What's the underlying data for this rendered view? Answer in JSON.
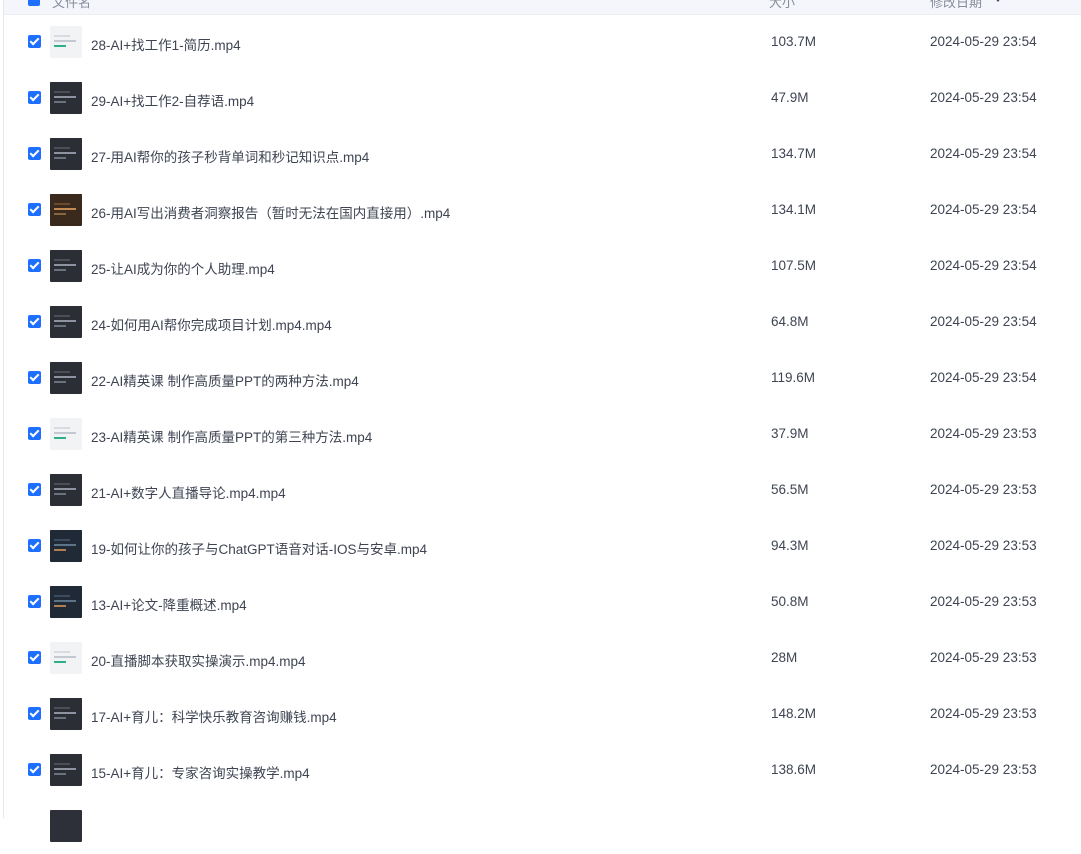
{
  "header": {
    "name_label": "文件名",
    "size_label": "大小",
    "date_label": "修改日期"
  },
  "rows": [
    {
      "name": "28-AI+找工作1-简历.mp4",
      "size": "103.7M",
      "date": "2024-05-29 23:54",
      "thumb": "light"
    },
    {
      "name": "29-AI+找工作2-自荐语.mp4",
      "size": "47.9M",
      "date": "2024-05-29 23:54",
      "thumb": "dark"
    },
    {
      "name": "27-用AI帮你的孩子秒背单词和秒记知识点.mp4",
      "size": "134.7M",
      "date": "2024-05-29 23:54",
      "thumb": "dark"
    },
    {
      "name": "26-用AI写出消费者洞察报告（暂时无法在国内直接用）.mp4",
      "size": "134.1M",
      "date": "2024-05-29 23:54",
      "thumb": "warm"
    },
    {
      "name": "25-让AI成为你的个人助理.mp4",
      "size": "107.5M",
      "date": "2024-05-29 23:54",
      "thumb": "dark"
    },
    {
      "name": "24-如何用AI帮你完成项目计划.mp4.mp4",
      "size": "64.8M",
      "date": "2024-05-29 23:54",
      "thumb": "dark"
    },
    {
      "name": "22-AI精英课 制作高质量PPT的两种方法.mp4",
      "size": "119.6M",
      "date": "2024-05-29 23:54",
      "thumb": "dark"
    },
    {
      "name": "23-AI精英课 制作高质量PPT的第三种方法.mp4",
      "size": "37.9M",
      "date": "2024-05-29 23:53",
      "thumb": "light"
    },
    {
      "name": "21-AI+数字人直播导论.mp4.mp4",
      "size": "56.5M",
      "date": "2024-05-29 23:53",
      "thumb": "dark"
    },
    {
      "name": "19-如何让你的孩子与ChatGPT语音对话-IOS与安卓.mp4",
      "size": "94.3M",
      "date": "2024-05-29 23:53",
      "thumb": "photo"
    },
    {
      "name": "13-AI+论文-降重概述.mp4",
      "size": "50.8M",
      "date": "2024-05-29 23:53",
      "thumb": "photo"
    },
    {
      "name": "20-直播脚本获取实操演示.mp4.mp4",
      "size": "28M",
      "date": "2024-05-29 23:53",
      "thumb": "light"
    },
    {
      "name": "17-AI+育儿：科学快乐教育咨询赚钱.mp4",
      "size": "148.2M",
      "date": "2024-05-29 23:53",
      "thumb": "dark"
    },
    {
      "name": "15-AI+育儿：专家咨询实操教学.mp4",
      "size": "138.6M",
      "date": "2024-05-29 23:53",
      "thumb": "dark"
    }
  ]
}
